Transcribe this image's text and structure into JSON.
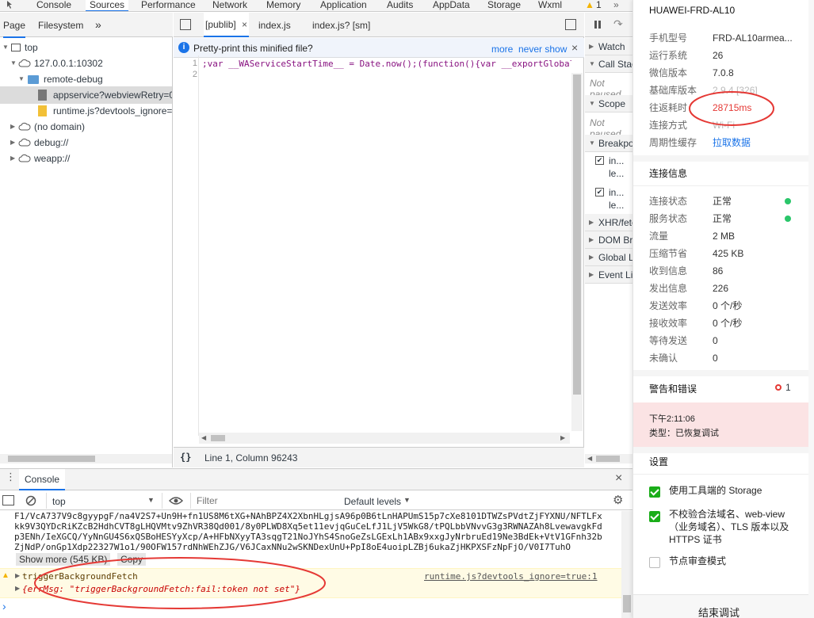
{
  "devtools": {
    "main_tabs": [
      "Console",
      "Sources",
      "Performance",
      "Network",
      "Memory",
      "Application",
      "Audits",
      "AppData",
      "Storage",
      "Wxml"
    ],
    "warning_count": "1",
    "navigator": {
      "tabs": [
        "Page",
        "Filesystem"
      ],
      "more": "»",
      "tree": [
        {
          "label": "top"
        },
        {
          "label": "127.0.0.1:10302"
        },
        {
          "label": "remote-debug"
        },
        {
          "label": "appservice?webviewRetry=0&"
        },
        {
          "label": "runtime.js?devtools_ignore="
        },
        {
          "label": "(no domain)"
        },
        {
          "label": "debug://"
        },
        {
          "label": "weapp://"
        }
      ]
    },
    "editor": {
      "tabs": [
        "[publib]",
        "index.js",
        "index.js? [sm]"
      ],
      "info_text": "Pretty-print this minified file?",
      "info_more": "more",
      "info_never": "never show",
      "lines": [
        "1",
        "2"
      ],
      "code_line_1": ";var __WAServiceStartTime__ = Date.now();(function(){var __exportGlobal",
      "status_braces": "{}",
      "status_text": "Line 1, Column 96243"
    },
    "debugger": {
      "sections": [
        "Watch",
        "Call Stack",
        "Scope",
        "Breakpoints",
        "XHR/fetch",
        "DOM Breakpoints",
        "Global Listeners",
        "Event Listener"
      ],
      "not_paused": "Not paused",
      "bp_text_1": "in...",
      "bp_text_2": "le..."
    },
    "console": {
      "tab": "Console",
      "context": "top",
      "filter_placeholder": "Filter",
      "levels": "Default levels",
      "b64_lines": [
        "F1/VcA737V9c8gyypgF/na4V2S7+Un9H+fn1US8M6tXG+NAhBPZ4X2XbnHLgjsA96p0B6tLnHAPUmS15p7cXe8101DTWZsPVdtZjFYXNU/NFTLFx",
        "kk9V3QYDcRiKZcB2HdhCVT8gLHQVMtv9ZhVR38Qd001/8y0PLWD8Xq5et11evjqGuCeLfJ1LjV5WkG8/tPQLbbVNvvG3g3RWNAZAh8LvewavgkFd",
        "p3ENh/IeXGCQ/YyNnGU4S6xQSBoHESYyXcp/A+HFbNXyyTA3sqgT21NoJYhS4SnoGeZsLGExLh1ABx9xxgJyNrbruEd19Ne3BdEk+VtV1GFnh32b",
        "ZjNdP/onGp1Xdp22327W1o1/90OFW157rdNhWEhZJG/V6JCaxNNu2wSKNDexUnU+PpI8oE4uoipLZBj6ukaZjHKPXSFzNpFjO/V0I7TuhO"
      ],
      "show_more": "Show more (545 KB)",
      "copy": "Copy",
      "warn_msg": "triggerBackgroundFetch",
      "warn_src": "runtime.js?devtools_ignore=true:1",
      "err_obj": "{errMsg: \"triggerBackgroundFetch:fail:token not set\"}",
      "prompt": "›"
    }
  },
  "phone_panel": {
    "device_title": "HUAWEI-FRD-AL10",
    "info": [
      {
        "key": "手机型号",
        "value": "FRD-AL10armea..."
      },
      {
        "key": "运行系统",
        "value": "26"
      },
      {
        "key": "微信版本",
        "value": "7.0.8"
      },
      {
        "key": "基础库版本",
        "value": "2.9.4 [326]"
      },
      {
        "key": "往返耗时",
        "value": "28715ms"
      },
      {
        "key": "连接方式",
        "value": "Wi-Fi"
      },
      {
        "key": "周期性缓存",
        "value": "拉取数据"
      }
    ],
    "conn_title": "连接信息",
    "conn": [
      {
        "key": "连接状态",
        "value": "正常"
      },
      {
        "key": "服务状态",
        "value": "正常"
      },
      {
        "key": "流量",
        "value": "2 MB"
      },
      {
        "key": "压缩节省",
        "value": "425 KB"
      },
      {
        "key": "收到信息",
        "value": "86"
      },
      {
        "key": "发出信息",
        "value": "226"
      },
      {
        "key": "发送效率",
        "value": "0 个/秒"
      },
      {
        "key": "接收效率",
        "value": "0 个/秒"
      },
      {
        "key": "等待发送",
        "value": "0"
      },
      {
        "key": "未确认",
        "value": "0"
      }
    ],
    "warn_title": "警告和错误",
    "warn_count": "1",
    "alert_time": "下午2:11:06",
    "alert_type": "类型：已恢复调试",
    "settings_title": "设置",
    "settings": [
      {
        "label": "使用工具端的 Storage",
        "checked": true
      },
      {
        "label": "不校验合法域名、web-view（业务域名）、TLS 版本以及 HTTPS 证书",
        "checked": true
      },
      {
        "label": "节点审查模式",
        "checked": false
      }
    ],
    "end_button": "结束调试"
  },
  "colors": {
    "accent": "#1a73e8",
    "green": "#1aad19",
    "red": "#e53935",
    "alert_bg": "#fbe3e4"
  }
}
